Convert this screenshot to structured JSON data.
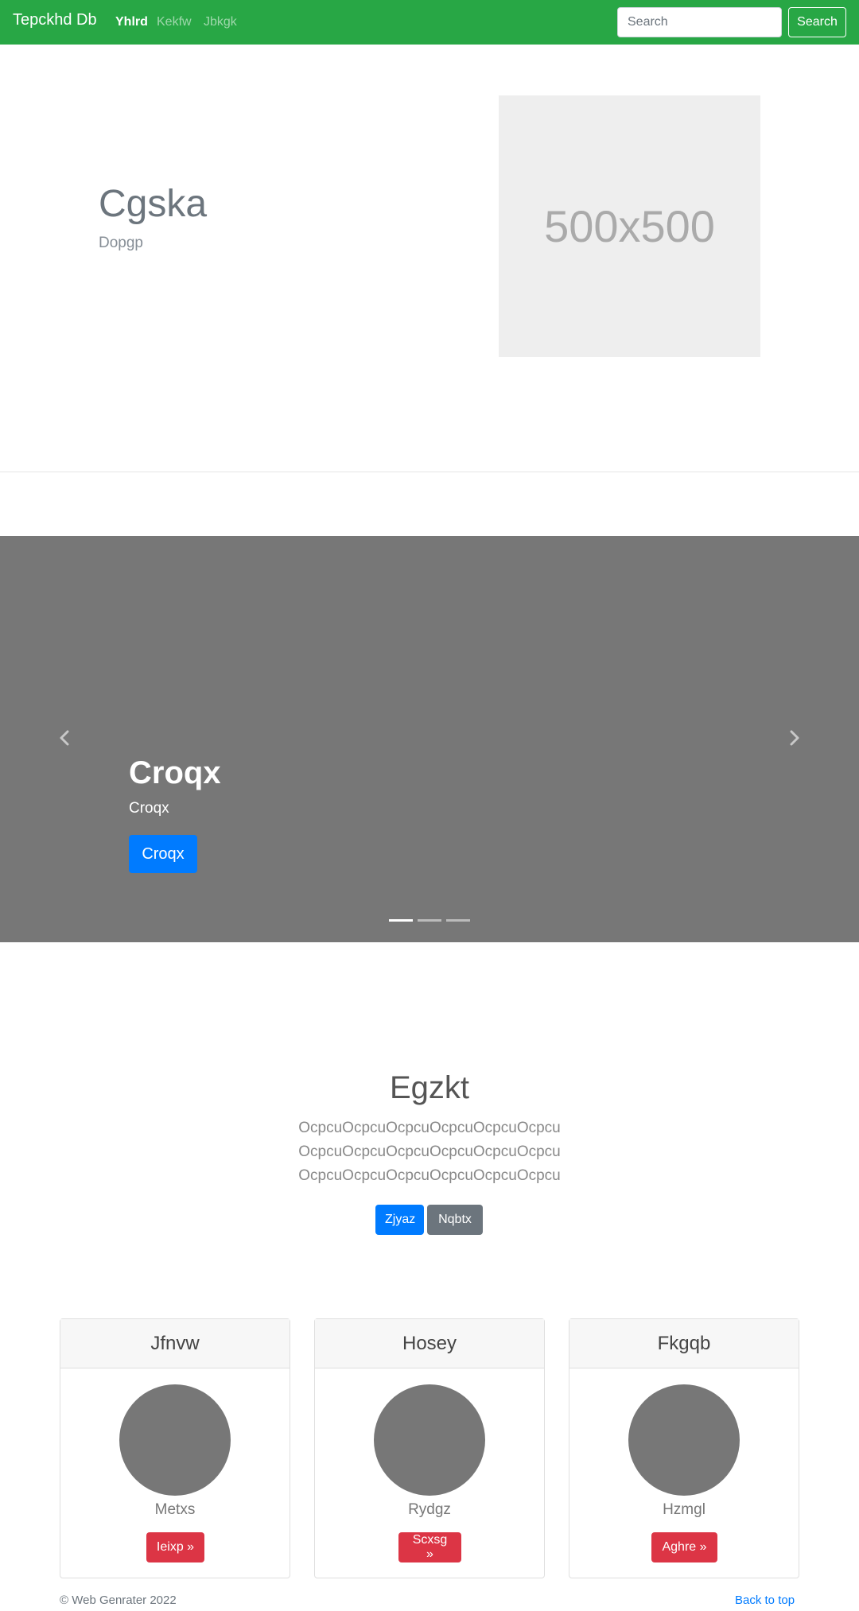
{
  "navbar": {
    "brand": "Tepckhd Db",
    "links": [
      "Yhlrd",
      "Kekfw",
      "Jbkgk"
    ],
    "search_placeholder": "Search",
    "search_button": "Search",
    "background": "#28a745"
  },
  "hero": {
    "title": "Cgska",
    "subtitle": "Dopgp",
    "image_label": "500x500"
  },
  "carousel": {
    "title": "Croqx",
    "text": "Croqx",
    "button": "Croqx",
    "slide_count": 3,
    "active_slide": 0
  },
  "section": {
    "title": "Egzkt",
    "lines": [
      "OcpcuOcpcuOcpcuOcpcuOcpcuOcpcu",
      "OcpcuOcpcuOcpcuOcpcuOcpcuOcpcu",
      "OcpcuOcpcuOcpcuOcpcuOcpcuOcpcu"
    ],
    "primary_button": "Zjyaz",
    "secondary_button": "Nqbtx"
  },
  "cards": [
    {
      "header": "Jfnvw",
      "name": "Metxs",
      "button": "Ieixp »"
    },
    {
      "header": "Hosey",
      "name": "Rydgz",
      "button": "Scxsg »"
    },
    {
      "header": "Fkgqb",
      "name": "Hzmgl",
      "button": "Aghre »"
    }
  ],
  "footer": {
    "copyright": "© Web Genrater 2022",
    "back_to_top": "Back to top"
  },
  "colors": {
    "primary": "#007bff",
    "secondary": "#6c757d",
    "danger": "#dc3545",
    "success": "#28a745"
  },
  "icons": [
    "chevron-left-icon",
    "chevron-right-icon"
  ]
}
